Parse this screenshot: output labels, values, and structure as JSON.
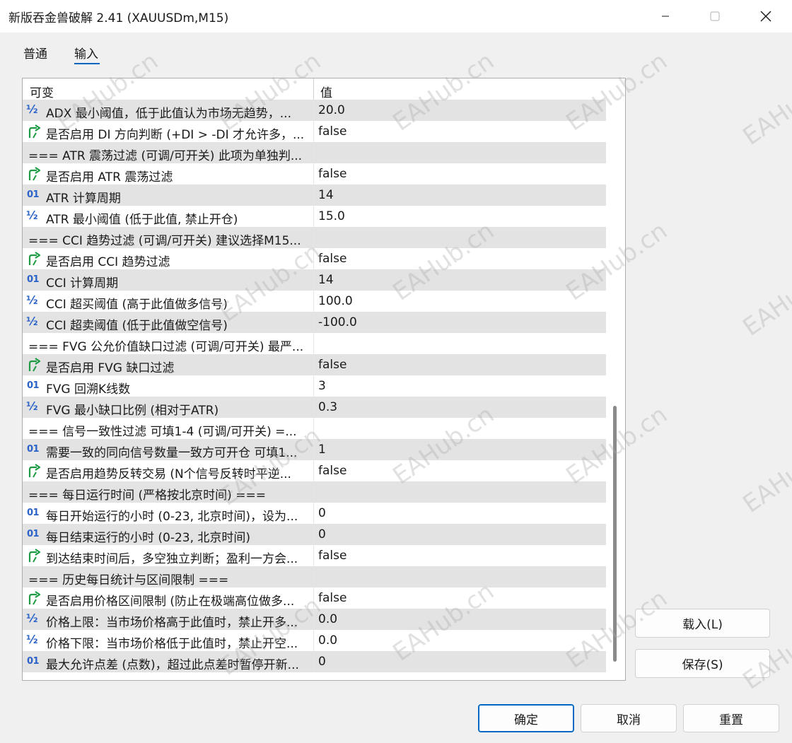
{
  "window": {
    "title": "新版吞金兽破解 2.41 (XAUUSDm,M15)"
  },
  "tabs": [
    {
      "label": "普通",
      "active": false
    },
    {
      "label": "输入",
      "active": true
    }
  ],
  "grid": {
    "header": {
      "variable": "可变",
      "value": "值"
    },
    "rows": [
      {
        "type": "double",
        "name": "ADX 最小阈值，低于此值认为市场无趋势，...",
        "value": "20.0"
      },
      {
        "type": "bool",
        "name": "是否启用 DI 方向判断 (+DI > -DI 才允许多，...",
        "value": "false"
      },
      {
        "type": "section",
        "name": "=== ATR 震荡过滤 (可调/可开关) 此项为单独判...",
        "value": ""
      },
      {
        "type": "bool",
        "name": "是否启用 ATR 震荡过滤",
        "value": "false"
      },
      {
        "type": "int",
        "name": "ATR 计算周期",
        "value": "14"
      },
      {
        "type": "double",
        "name": "ATR 最小阈值 (低于此值, 禁止开仓)",
        "value": "15.0"
      },
      {
        "type": "section",
        "name": "=== CCI 趋势过滤 (可调/可开关) 建议选择M15...",
        "value": ""
      },
      {
        "type": "bool",
        "name": "是否启用 CCI 趋势过滤",
        "value": "false"
      },
      {
        "type": "int",
        "name": "CCI 计算周期",
        "value": "14"
      },
      {
        "type": "double",
        "name": "CCI 超买阈值 (高于此值做多信号)",
        "value": "100.0"
      },
      {
        "type": "double",
        "name": "CCI 超卖阈值 (低于此值做空信号)",
        "value": "-100.0"
      },
      {
        "type": "section",
        "name": "=== FVG 公允价值缺口过滤 (可调/可开关) 最严...",
        "value": ""
      },
      {
        "type": "bool",
        "name": "是否启用 FVG 缺口过滤",
        "value": "false"
      },
      {
        "type": "int",
        "name": "FVG 回溯K线数",
        "value": "3"
      },
      {
        "type": "double",
        "name": "FVG 最小缺口比例 (相对于ATR)",
        "value": "0.3"
      },
      {
        "type": "section",
        "name": "=== 信号一致性过滤 可填1-4 (可调/可开关) =...",
        "value": ""
      },
      {
        "type": "int",
        "name": "需要一致的同向信号数量一致方可开仓 可填1...",
        "value": "1"
      },
      {
        "type": "bool",
        "name": "是否启用趋势反转交易 (N个信号反转时平逆...",
        "value": "false"
      },
      {
        "type": "section",
        "name": "=== 每日运行时间 (严格按北京时间) ===",
        "value": ""
      },
      {
        "type": "int",
        "name": "每日开始运行的小时 (0-23, 北京时间)，设为...",
        "value": "0"
      },
      {
        "type": "int",
        "name": "每日结束运行的小时 (0-23, 北京时间)",
        "value": "0"
      },
      {
        "type": "bool",
        "name": "到达结束时间后，多空独立判断；盈利一方会...",
        "value": "false"
      },
      {
        "type": "section",
        "name": "=== 历史每日统计与区间限制 ===",
        "value": ""
      },
      {
        "type": "bool",
        "name": "是否启用价格区间限制 (防止在极端高位做多...",
        "value": "false"
      },
      {
        "type": "double",
        "name": "价格上限：当市场价格高于此值时，禁止开多...",
        "value": "0.0"
      },
      {
        "type": "double",
        "name": "价格下限：当市场价格低于此值时，禁止开空...",
        "value": "0.0"
      },
      {
        "type": "int",
        "name": "最大允许点差 (点数)，超过此点差时暂停开新...",
        "value": "0"
      }
    ]
  },
  "icons": {
    "int": "01",
    "double": "½",
    "bool": "bool-arrow-icon"
  },
  "side_buttons": {
    "load": "载入(L)",
    "save": "保存(S)"
  },
  "footer_buttons": {
    "ok": "确定",
    "cancel": "取消",
    "reset": "重置"
  },
  "watermark": "EAHub.cn",
  "colors": {
    "accent": "#0067c0",
    "icon_blue": "#2a62c8",
    "icon_green": "#1f9a45",
    "row_alt": "#e3e3e3"
  }
}
